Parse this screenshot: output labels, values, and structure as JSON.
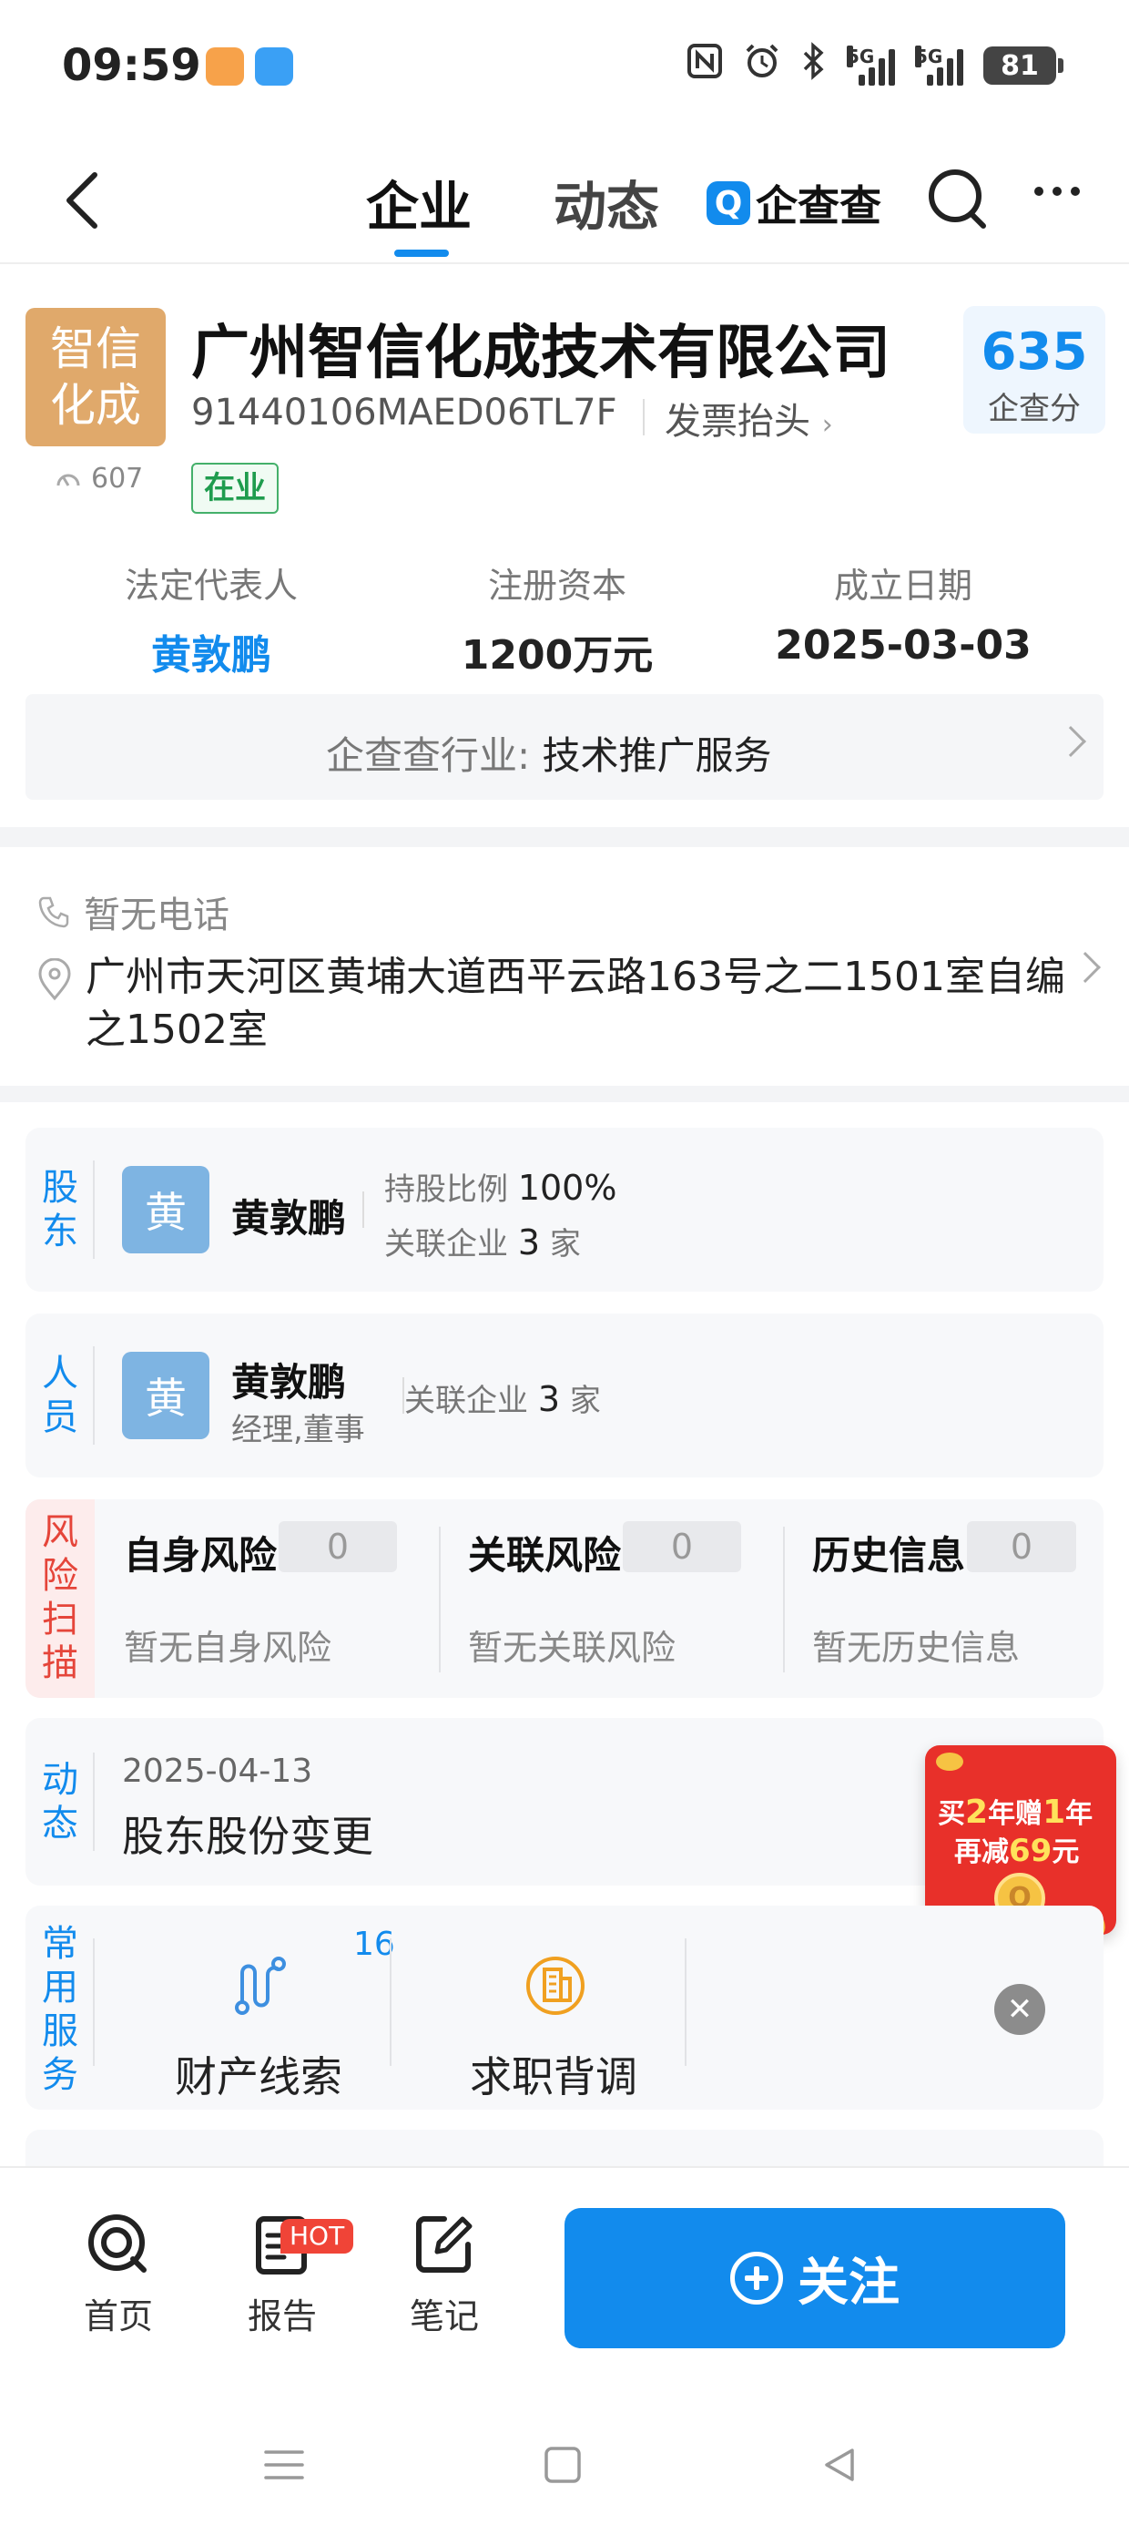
{
  "status_bar": {
    "time": "09:59",
    "signal1_tag": "5G",
    "signal2_tag": "5G",
    "battery": "81"
  },
  "nav": {
    "tab_company": "企业",
    "tab_dynamics": "动态",
    "brand": "企查查",
    "brand_mark": "Q"
  },
  "company": {
    "logo_line1": "智信",
    "logo_line2": "化成",
    "popularity": "607",
    "name": "广州智信化成技术有限公司",
    "credit_code": "91440106MAED06TL7F",
    "invoice_link": "发票抬头",
    "status": "在业",
    "score_value": "635",
    "score_label": "企查分"
  },
  "info": {
    "legal_rep_label": "法定代表人",
    "legal_rep_value": "黄敦鹏",
    "capital_label": "注册资本",
    "capital_value": "1200万元",
    "founded_label": "成立日期",
    "founded_value": "2025-03-03",
    "industry_label": "企查查行业:",
    "industry_value": "技术推广服务"
  },
  "contact": {
    "phone": "暂无电话",
    "address": "广州市天河区黄埔大道西平云路163号之二1501室自编之1502室"
  },
  "shareholder": {
    "tag": "股东",
    "avatar": "黄",
    "name": "黄敦鹏",
    "ratio_label": "持股比例",
    "ratio_value": "100%",
    "related_label": "关联企业",
    "related_count": "3",
    "related_unit": "家"
  },
  "personnel": {
    "tag": "人员",
    "avatar": "黄",
    "name": "黄敦鹏",
    "role": "经理,董事",
    "related_label": "关联企业",
    "related_count": "3",
    "related_unit": "家"
  },
  "risk": {
    "tag": "风险扫描",
    "items": [
      {
        "title": "自身风险",
        "count": "0",
        "desc": "暂无自身风险"
      },
      {
        "title": "关联风险",
        "count": "0",
        "desc": "暂无关联风险"
      },
      {
        "title": "历史信息",
        "count": "0",
        "desc": "暂无历史信息"
      }
    ]
  },
  "dynamics": {
    "tag": "动态",
    "date": "2025-04-13",
    "title": "股东股份变更"
  },
  "promo": {
    "line1_a": "买",
    "line1_b": "2",
    "line1_c": "年赠",
    "line1_d": "1",
    "line1_e": "年",
    "line2_a": "再减",
    "line2_b": "69",
    "line2_c": "元"
  },
  "services": {
    "tag": "常用服务",
    "badge": "16",
    "items": [
      {
        "label": "财产线索",
        "icon": "property-clue-icon"
      },
      {
        "label": "求职背调",
        "icon": "job-check-icon"
      }
    ]
  },
  "bottom_bar": {
    "home": "首页",
    "report": "报告",
    "hot": "HOT",
    "notes": "笔记",
    "follow": "关注"
  },
  "colors": {
    "accent": "#128bed",
    "risk": "#e5453a",
    "logo_bg": "#e0a96b",
    "status_green": "#1f9c4e"
  }
}
